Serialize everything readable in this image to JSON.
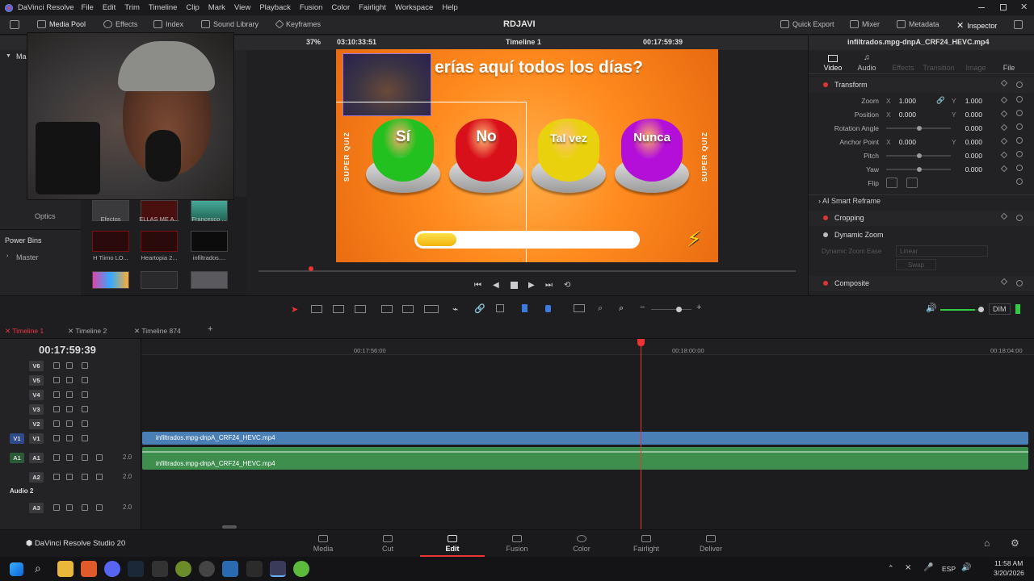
{
  "menubar": {
    "app_name": "DaVinci Resolve",
    "items": [
      "File",
      "Edit",
      "Trim",
      "Timeline",
      "Clip",
      "Mark",
      "View",
      "Playback",
      "Fusion",
      "Color",
      "Fairlight",
      "Workspace",
      "Help"
    ]
  },
  "toolbar": {
    "media_pool": "Media Pool",
    "effects": "Effects",
    "index": "Index",
    "sound_library": "Sound Library",
    "keyframes": "Keyframes",
    "project_name": "RDJAVI",
    "quick_export": "Quick Export",
    "mixer": "Mixer",
    "metadata": "Metadata",
    "inspector": "Inspector"
  },
  "viewer": {
    "zoom": "37%",
    "source_timecode": "03:10:33:51",
    "timeline_name": "Timeline 1",
    "record_timecode": "00:17:59:39",
    "scrub_position": 0.1
  },
  "program": {
    "question": "erías aquí todos los días?",
    "side_label": "SUPER QUIZ",
    "buttons": [
      {
        "label": "Sí",
        "color": "#22c11f"
      },
      {
        "label": "No",
        "color": "#d8101a"
      },
      {
        "label": "Tal vez",
        "color": "#e9d10d"
      },
      {
        "label": "Nunca",
        "color": "#b30fd8"
      }
    ],
    "progress": 0.18
  },
  "left_panel": {
    "master": "Mas",
    "optics": "Optics",
    "power_bins": "Power Bins",
    "master_bin": "Master",
    "thumbs": [
      "Efectos",
      "ELLAS ME A...",
      "Francesco ...",
      "H Tiimo LO...",
      "Heartopia 2...",
      "infiltrados...."
    ]
  },
  "inspector": {
    "clip_name": "infiltrados.mpg-dnpA_CRF24_HEVC.mp4",
    "tabs": [
      "Video",
      "Audio",
      "Effects",
      "Transition",
      "Image",
      "File"
    ],
    "transform": "Transform",
    "rows": [
      {
        "label": "Zoom",
        "x": "1.000",
        "y": "1.000"
      },
      {
        "label": "Position",
        "x": "0.000",
        "y": "0.000"
      },
      {
        "label": "Rotation Angle",
        "v": "0.000"
      },
      {
        "label": "Anchor Point",
        "x": "0.000",
        "y": "0.000"
      },
      {
        "label": "Pitch",
        "v": "0.000"
      },
      {
        "label": "Yaw",
        "v": "0.000"
      },
      {
        "label": "Flip"
      }
    ],
    "ai_smart_reframe": "AI Smart Reframe",
    "cropping": "Cropping",
    "dynamic_zoom": "Dynamic Zoom",
    "dynamic_zoom_ease": "Dynamic Zoom Ease",
    "ease_value": "Linear",
    "swap": "Swap",
    "composite": "Composite"
  },
  "audio": {
    "dim": "DIM",
    "volume": 0.82
  },
  "timeline": {
    "tabs": [
      "Timeline 1",
      "Timeline 2",
      "Timeline 874"
    ],
    "timecode": "00:17:59:39",
    "ruler": [
      "00:17:56:00",
      "00:18:00:00",
      "00:18:04:00"
    ],
    "video_tracks": [
      "V6",
      "V5",
      "V4",
      "V3",
      "V2",
      "V1"
    ],
    "video_clip": "infiltrados.mpg-dnpA_CRF24_HEVC.mp4",
    "audio_clip": "infiltrados.mpg-dnpA_CRF24_HEVC.mp4",
    "audio_tracks": [
      {
        "name": "A1",
        "level": "2.0"
      },
      {
        "name": "A2",
        "level": "2.0"
      },
      {
        "name": "A3",
        "level": "2.0"
      }
    ],
    "audio2_label": "Audio 2",
    "v1_src": "V1",
    "a1_src": "A1"
  },
  "pages": {
    "brand": "DaVinci Resolve Studio 20",
    "items": [
      "Media",
      "Cut",
      "Edit",
      "Fusion",
      "Color",
      "Fairlight",
      "Deliver"
    ],
    "active": "Edit"
  },
  "taskbar": {
    "lang": "ESP",
    "time": "11:58 AM",
    "date": "3/20/2026"
  }
}
